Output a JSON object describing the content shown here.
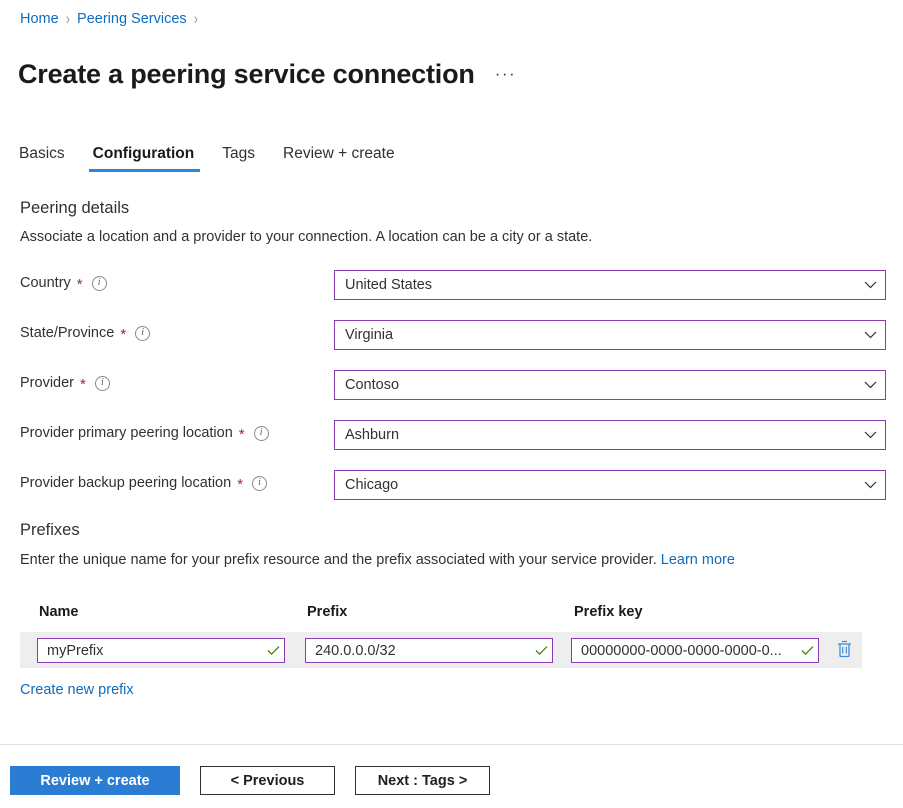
{
  "breadcrumb": {
    "items": [
      {
        "label": "Home"
      },
      {
        "label": "Peering Services"
      }
    ],
    "separator": "›"
  },
  "header": {
    "title": "Create a peering service connection",
    "more_actions": "···",
    "more_actions_name": "more-actions"
  },
  "tabs": [
    {
      "label": "Basics",
      "active": false
    },
    {
      "label": "Configuration",
      "active": true
    },
    {
      "label": "Tags",
      "active": false
    },
    {
      "label": "Review + create",
      "active": false
    }
  ],
  "peering_details": {
    "section_title": "Peering details",
    "description": "Associate a location and a provider to your connection. A location can be a city or a state.",
    "fields": [
      {
        "label": "Country",
        "required": true,
        "info": true,
        "value": "United States"
      },
      {
        "label": "State/Province",
        "required": true,
        "info": true,
        "value": "Virginia"
      },
      {
        "label": "Provider",
        "required": true,
        "info": true,
        "value": "Contoso"
      },
      {
        "label": "Provider primary peering location",
        "required": true,
        "info": true,
        "value": "Ashburn"
      },
      {
        "label": "Provider backup peering location",
        "required": true,
        "info": true,
        "value": "Chicago"
      }
    ]
  },
  "prefixes": {
    "section_title": "Prefixes",
    "description": "Enter the unique name for your prefix resource and the prefix associated with your service provider.",
    "learn_more": "Learn more",
    "columns": [
      "Name",
      "Prefix",
      "Prefix key"
    ],
    "rows": [
      {
        "name": "myPrefix",
        "name_placeholder": "Name",
        "name_valid": true,
        "prefix": "240.0.0.0/32",
        "prefix_placeholder": "Prefix",
        "prefix_valid": true,
        "prefix_key": "00000000-0000-0000-0000-0...",
        "prefix_key_placeholder": "Prefix key",
        "prefix_key_valid": true,
        "delete_label": "Delete"
      }
    ],
    "create_link": "Create new prefix"
  },
  "footer": {
    "review_create": "Review + create",
    "previous": "< Previous",
    "next": "Next : Tags >"
  },
  "colors": {
    "accent_blue": "#2b7cd3",
    "link_blue": "#0f6cbd",
    "tab_underline": "#2b88d8",
    "input_border": "#8a3ab0",
    "required_red": "#a4262c",
    "valid_green": "#498205",
    "row_background": "#eeeeee",
    "text": "#323130"
  }
}
